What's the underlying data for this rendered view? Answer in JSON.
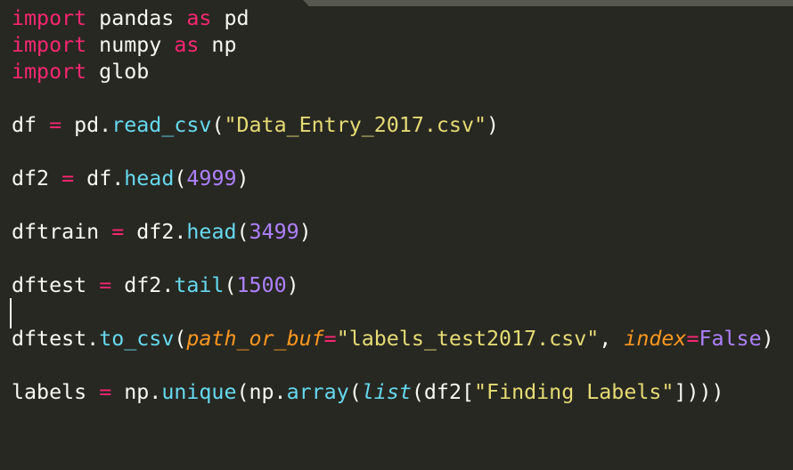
{
  "colors": {
    "background": "#272822",
    "keyword": "#f92672",
    "operator": "#f92672",
    "function": "#66d9ef",
    "string": "#e6db74",
    "number": "#ae81ff",
    "parameter": "#fd971f",
    "constant": "#ae81ff",
    "text": "#f8f8f2"
  },
  "editor": {
    "lines": [
      [
        {
          "t": "import",
          "c": "kw"
        },
        {
          "t": " pandas ",
          "c": "plain"
        },
        {
          "t": "as",
          "c": "kw"
        },
        {
          "t": " pd",
          "c": "plain"
        }
      ],
      [
        {
          "t": "import",
          "c": "kw"
        },
        {
          "t": " numpy ",
          "c": "plain"
        },
        {
          "t": "as",
          "c": "kw"
        },
        {
          "t": " np",
          "c": "plain"
        }
      ],
      [
        {
          "t": "import",
          "c": "kw"
        },
        {
          "t": " glob",
          "c": "plain"
        }
      ],
      [],
      [
        {
          "t": "df ",
          "c": "plain"
        },
        {
          "t": "=",
          "c": "op"
        },
        {
          "t": " pd.",
          "c": "plain"
        },
        {
          "t": "read_csv",
          "c": "fn"
        },
        {
          "t": "(",
          "c": "plain"
        },
        {
          "t": "\"Data_Entry_2017.csv\"",
          "c": "str"
        },
        {
          "t": ")",
          "c": "plain"
        }
      ],
      [],
      [
        {
          "t": "df2 ",
          "c": "plain"
        },
        {
          "t": "=",
          "c": "op"
        },
        {
          "t": " df.",
          "c": "plain"
        },
        {
          "t": "head",
          "c": "fn"
        },
        {
          "t": "(",
          "c": "plain"
        },
        {
          "t": "4999",
          "c": "num"
        },
        {
          "t": ")",
          "c": "plain"
        }
      ],
      [],
      [
        {
          "t": "dftrain ",
          "c": "plain"
        },
        {
          "t": "=",
          "c": "op"
        },
        {
          "t": " df2.",
          "c": "plain"
        },
        {
          "t": "head",
          "c": "fn"
        },
        {
          "t": "(",
          "c": "plain"
        },
        {
          "t": "3499",
          "c": "num"
        },
        {
          "t": ")",
          "c": "plain"
        }
      ],
      [],
      [
        {
          "t": "dftest ",
          "c": "plain"
        },
        {
          "t": "=",
          "c": "op"
        },
        {
          "t": " df2.",
          "c": "plain"
        },
        {
          "t": "tail",
          "c": "fn"
        },
        {
          "t": "(",
          "c": "plain"
        },
        {
          "t": "1500",
          "c": "num"
        },
        {
          "t": ")",
          "c": "plain"
        }
      ],
      [],
      [
        {
          "t": "dftest.",
          "c": "plain"
        },
        {
          "t": "to_csv",
          "c": "fn"
        },
        {
          "t": "(",
          "c": "plain"
        },
        {
          "t": "path_or_buf",
          "c": "param"
        },
        {
          "t": "=",
          "c": "op"
        },
        {
          "t": "\"labels_test2017.csv\"",
          "c": "str"
        },
        {
          "t": ", ",
          "c": "plain"
        },
        {
          "t": "index",
          "c": "param"
        },
        {
          "t": "=",
          "c": "op"
        },
        {
          "t": "False",
          "c": "const"
        },
        {
          "t": ")",
          "c": "plain"
        }
      ],
      [],
      [
        {
          "t": "labels ",
          "c": "plain"
        },
        {
          "t": "=",
          "c": "op"
        },
        {
          "t": " np.",
          "c": "plain"
        },
        {
          "t": "unique",
          "c": "fn"
        },
        {
          "t": "(np.",
          "c": "plain"
        },
        {
          "t": "array",
          "c": "fn"
        },
        {
          "t": "(",
          "c": "plain"
        },
        {
          "t": "list",
          "c": "builtin"
        },
        {
          "t": "(df2[",
          "c": "plain"
        },
        {
          "t": "\"Finding Labels\"",
          "c": "str"
        },
        {
          "t": "])))",
          "c": "plain"
        }
      ]
    ]
  }
}
